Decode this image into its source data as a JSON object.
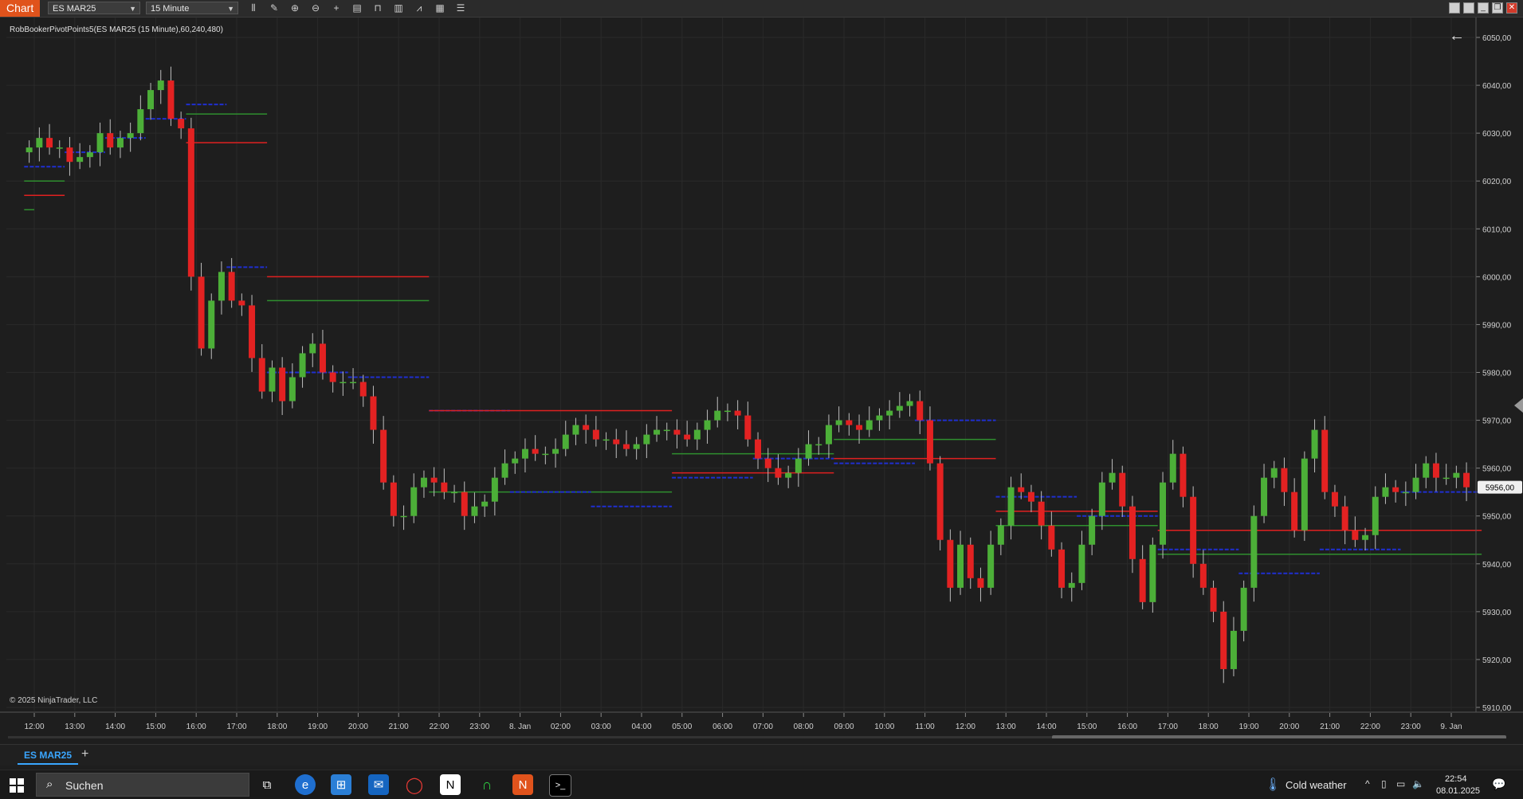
{
  "toolbar": {
    "app_tab": "Chart",
    "instrument": "ES MAR25",
    "interval": "15 Minute",
    "tools": [
      "bar-type-icon",
      "pencil-icon",
      "zoom-in-icon",
      "zoom-out-icon",
      "crosshair-icon",
      "data-box-icon",
      "properties-icon",
      "strategy-icon",
      "indicator-icon",
      "drawing-tools-icon",
      "list-icon"
    ]
  },
  "chart": {
    "indicator_label": "RobBookerPivotPoints5(ES MAR25 (15 Minute),60,240,480)",
    "copyright": "© 2025 NinjaTrader, LLC",
    "current_price_label": "5956,00",
    "colors": {
      "background": "#1e1e1e",
      "up": "#4caf38",
      "down": "#e32222",
      "pivot_red": "#e02020",
      "pivot_green": "#2f8f2f",
      "pivot_blue": "#1f2fd0",
      "grid": "#2a2a2a",
      "axis_text": "#d0d0d0"
    }
  },
  "chart_data": {
    "type": "candlestick",
    "instrument": "ES MAR25",
    "interval": "15 Minute",
    "y_axis": {
      "min": 5910,
      "max": 6050,
      "ticks": [
        "6050,00",
        "6040,00",
        "6030,00",
        "6020,00",
        "6010,00",
        "6000,00",
        "5990,00",
        "5980,00",
        "5970,00",
        "5960,00",
        "5950,00",
        "5940,00",
        "5930,00",
        "5920,00",
        "5910,00"
      ]
    },
    "x_axis": {
      "ticks": [
        "12:00",
        "13:00",
        "14:00",
        "15:00",
        "16:00",
        "17:00",
        "18:00",
        "19:00",
        "20:00",
        "21:00",
        "22:00",
        "23:00",
        "8. Jan",
        "02:00",
        "03:00",
        "04:00",
        "05:00",
        "06:00",
        "07:00",
        "08:00",
        "09:00",
        "10:00",
        "11:00",
        "12:00",
        "13:00",
        "14:00",
        "15:00",
        "16:00",
        "17:00",
        "18:00",
        "19:00",
        "20:00",
        "21:00",
        "22:00",
        "23:00",
        "9. Jan"
      ]
    },
    "start_slot": 0,
    "close_path": [
      6027,
      6029,
      6027,
      6027,
      6024,
      6025,
      6026,
      6030,
      6027,
      6029,
      6030,
      6035,
      6039,
      6041,
      6033,
      6031,
      6000,
      5985,
      5995,
      6001,
      5995,
      5994,
      5983,
      5976,
      5981,
      5974,
      5979,
      5984,
      5986,
      5980,
      5978,
      5978,
      5978,
      5975,
      5968,
      5957,
      5950,
      5950,
      5956,
      5958,
      5957,
      5955,
      5955,
      5950,
      5952,
      5953,
      5958,
      5961,
      5962,
      5964,
      5963,
      5963,
      5964,
      5967,
      5969,
      5968,
      5966,
      5966,
      5965,
      5964,
      5965,
      5967,
      5968,
      5968,
      5967,
      5966,
      5968,
      5970,
      5972,
      5972,
      5971,
      5966,
      5962,
      5960,
      5958,
      5959,
      5962,
      5965,
      5965,
      5969,
      5970,
      5969,
      5968,
      5970,
      5971,
      5972,
      5973,
      5974,
      5970,
      5961,
      5945,
      5935,
      5944,
      5937,
      5935,
      5944,
      5948,
      5956,
      5955,
      5953,
      5948,
      5943,
      5935,
      5936,
      5944,
      5950,
      5957,
      5959,
      5952,
      5941,
      5932,
      5944,
      5957,
      5963,
      5954,
      5940,
      5935,
      5930,
      5918,
      5926,
      5935,
      5950,
      5958,
      5960,
      5955,
      5947,
      5962,
      5968,
      5955,
      5952,
      5947,
      5945,
      5946,
      5954,
      5956,
      5955,
      5955,
      5958,
      5961,
      5958,
      5958,
      5959,
      5956
    ],
    "pivots": [
      {
        "color": "red",
        "start": 0,
        "end": 4,
        "price": 6017
      },
      {
        "color": "green",
        "start": 0,
        "end": 4,
        "price": 6020
      },
      {
        "color": "blue",
        "start": 0,
        "end": 4,
        "price": 6023
      },
      {
        "color": "green",
        "start": 0,
        "end": 1,
        "price": 6014
      },
      {
        "color": "blue",
        "start": 4,
        "end": 8,
        "price": 6026
      },
      {
        "color": "blue",
        "start": 8,
        "end": 12,
        "price": 6029
      },
      {
        "color": "blue",
        "start": 12,
        "end": 16,
        "price": 6033
      },
      {
        "color": "red",
        "start": 16,
        "end": 24,
        "price": 6028
      },
      {
        "color": "green",
        "start": 16,
        "end": 24,
        "price": 6034
      },
      {
        "color": "blue",
        "start": 16,
        "end": 20,
        "price": 6036
      },
      {
        "color": "blue",
        "start": 20,
        "end": 24,
        "price": 6002
      },
      {
        "color": "red",
        "start": 24,
        "end": 40,
        "price": 6000
      },
      {
        "color": "green",
        "start": 24,
        "end": 40,
        "price": 5995
      },
      {
        "color": "blue",
        "start": 24,
        "end": 32,
        "price": 5980
      },
      {
        "color": "blue",
        "start": 32,
        "end": 40,
        "price": 5979
      },
      {
        "color": "blue",
        "start": 40,
        "end": 48,
        "price": 5972
      },
      {
        "color": "red",
        "start": 40,
        "end": 64,
        "price": 5972
      },
      {
        "color": "green",
        "start": 40,
        "end": 64,
        "price": 5955
      },
      {
        "color": "blue",
        "start": 48,
        "end": 56,
        "price": 5955
      },
      {
        "color": "blue",
        "start": 56,
        "end": 64,
        "price": 5952
      },
      {
        "color": "red",
        "start": 64,
        "end": 80,
        "price": 5959
      },
      {
        "color": "green",
        "start": 64,
        "end": 80,
        "price": 5963
      },
      {
        "color": "blue",
        "start": 64,
        "end": 72,
        "price": 5958
      },
      {
        "color": "blue",
        "start": 72,
        "end": 80,
        "price": 5962
      },
      {
        "color": "red",
        "start": 80,
        "end": 96,
        "price": 5962
      },
      {
        "color": "green",
        "start": 80,
        "end": 96,
        "price": 5966
      },
      {
        "color": "blue",
        "start": 80,
        "end": 88,
        "price": 5961
      },
      {
        "color": "blue",
        "start": 88,
        "end": 96,
        "price": 5970
      },
      {
        "color": "red",
        "start": 96,
        "end": 112,
        "price": 5951
      },
      {
        "color": "green",
        "start": 96,
        "end": 112,
        "price": 5948
      },
      {
        "color": "blue",
        "start": 96,
        "end": 104,
        "price": 5954
      },
      {
        "color": "blue",
        "start": 104,
        "end": 112,
        "price": 5950
      },
      {
        "color": "red",
        "start": 112,
        "end": 144,
        "price": 5947
      },
      {
        "color": "green",
        "start": 112,
        "end": 144,
        "price": 5942
      },
      {
        "color": "blue",
        "start": 112,
        "end": 120,
        "price": 5943
      },
      {
        "color": "blue",
        "start": 120,
        "end": 128,
        "price": 5938
      },
      {
        "color": "blue",
        "start": 128,
        "end": 136,
        "price": 5943
      },
      {
        "color": "blue",
        "start": 136,
        "end": 144,
        "price": 5955
      }
    ]
  },
  "tabs": {
    "active": "ES MAR25",
    "add": "+"
  },
  "taskbar": {
    "search_placeholder": "Suchen",
    "weather": "Cold weather",
    "time": "22:54",
    "date": "08.01.2025"
  }
}
